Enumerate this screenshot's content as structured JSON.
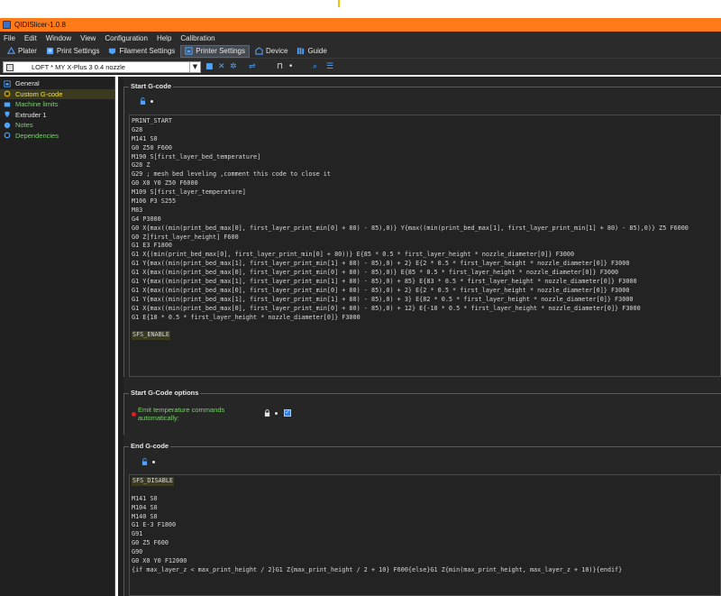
{
  "window": {
    "title": "QIDISlicer-1.0.8"
  },
  "menu": [
    "File",
    "Edit",
    "Window",
    "View",
    "Configuration",
    "Help",
    "Calibration"
  ],
  "tabs": [
    {
      "label": "Plater",
      "icon": "plater-icon",
      "active": false
    },
    {
      "label": "Print Settings",
      "icon": "print-settings-icon",
      "active": false
    },
    {
      "label": "Filament Settings",
      "icon": "filament-settings-icon",
      "active": false
    },
    {
      "label": "Printer Settings",
      "icon": "printer-settings-icon",
      "active": true
    },
    {
      "label": "Device",
      "icon": "device-icon",
      "active": false
    },
    {
      "label": "Guide",
      "icon": "guide-icon",
      "active": false
    }
  ],
  "preset": {
    "value": "LOFT * MY X-Plus 3 0.4 nozzle"
  },
  "sidebar": {
    "items": [
      {
        "label": "General",
        "color": "#e6e6e6",
        "icon": "printer-icon",
        "selected": false
      },
      {
        "label": "Custom G-code",
        "color": "#f0e24a",
        "icon": "gcode-icon",
        "selected": true
      },
      {
        "label": "Machine limits",
        "color": "#7bd16e",
        "icon": "machine-limits-icon",
        "selected": false
      },
      {
        "label": "Extruder 1",
        "color": "#e6e6e6",
        "icon": "extruder-icon",
        "selected": false
      },
      {
        "label": "Notes",
        "color": "#7bd16e",
        "icon": "notes-icon",
        "selected": false
      },
      {
        "label": "Dependencies",
        "color": "#7bd16e",
        "icon": "dependencies-icon",
        "selected": false
      }
    ]
  },
  "start_gcode": {
    "title": "Start G-code",
    "lines": [
      "PRINT_START",
      "G28",
      "M141 S0",
      "G0 Z50 F600",
      "M190 S[first_layer_bed_temperature]",
      "G28 Z",
      "G29 ; mesh bed leveling ,comment this code to close it",
      "G0 X0 Y0 Z50 F6000",
      "M109 S[first_layer_temperature]",
      "M106 P3 S255",
      "M83",
      "G4 P3000",
      "G0 X{max((min(print_bed_max[0], first_layer_print_min[0] + 80) - 85),0)} Y{max((min(print_bed_max[1], first_layer_print_min[1] + 80) - 85),0)} Z5 F6000",
      "G0 Z[first_layer_height] F600",
      "G1 E3 F1800",
      "G1 X{(min(print_bed_max[0], first_layer_print_min[0] + 80))} E{85 * 0.5 * first_layer_height * nozzle_diameter[0]} F3000",
      "G1 Y{max((min(print_bed_max[1], first_layer_print_min[1] + 80) - 85),0) + 2} E{2 * 0.5 * first_layer_height * nozzle_diameter[0]} F3000",
      "G1 X{max((min(print_bed_max[0], first_layer_print_min[0] + 80) - 85),0)} E{85 * 0.5 * first_layer_height * nozzle_diameter[0]} F3000",
      "G1 Y{max((min(print_bed_max[1], first_layer_print_min[1] + 80) - 85),0) + 85} E{83 * 0.5 * first_layer_height * nozzle_diameter[0]} F3000",
      "G1 X{max((min(print_bed_max[0], first_layer_print_min[0] + 80) - 85),0) + 2} E{2 * 0.5 * first_layer_height * nozzle_diameter[0]} F3000",
      "G1 Y{max((min(print_bed_max[1], first_layer_print_min[1] + 80) - 85),0) + 3} E{82 * 0.5 * first_layer_height * nozzle_diameter[0]} F3000",
      "G1 X{max((min(print_bed_max[0], first_layer_print_min[0] + 80) - 85),0) + 12} E{-10 * 0.5 * first_layer_height * nozzle_diameter[0]} F3000",
      "G1 E{10 * 0.5 * first_layer_height * nozzle_diameter[0]} F3000",
      "",
      "SFS_ENABLE"
    ]
  },
  "start_options": {
    "title": "Start G-Code options",
    "emit_label": "Emit temperature commands automatically:",
    "emit_checked": true
  },
  "end_gcode": {
    "title": "End G-code",
    "lines": [
      "SFS_DISABLE",
      "",
      "M141 S0",
      "M104 S0",
      "M140 S0",
      "G1 E-3 F1800",
      "G91",
      "G0 Z5 F600",
      "G90",
      "G0 X0 Y0 F12000",
      "{if max_layer_z < max_print_height / 2}G1 Z{max_print_height / 2 + 10} F600{else}G1 Z{min(max_print_height, max_layer_z + 10)}{endif}"
    ]
  },
  "colors": {
    "accent": "#ff7a18",
    "highlight": "#3c3a1e",
    "modified": "#7bd16e",
    "lock": "#4da3ff"
  }
}
